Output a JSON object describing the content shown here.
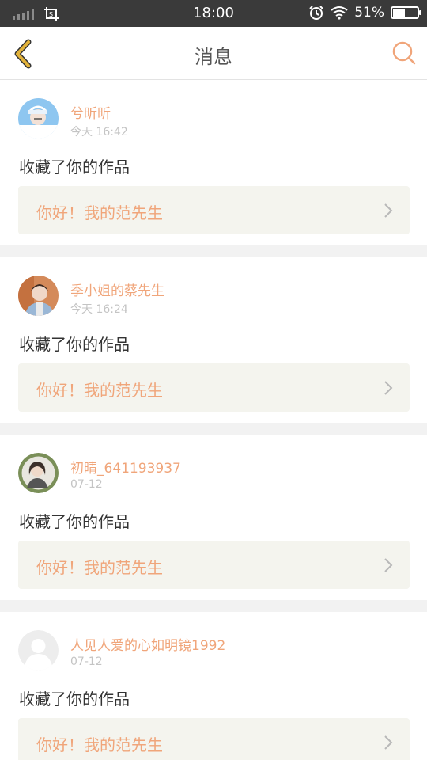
{
  "status_bar": {
    "time": "18:00",
    "battery_text": "51%",
    "battery_level": 0.51,
    "icons": [
      "signal-icon",
      "screenshot-crop-icon",
      "alarm-icon",
      "wifi-icon",
      "battery-icon"
    ]
  },
  "header": {
    "title": "消息",
    "back_icon": "chevron-left-icon",
    "search_icon": "search-icon"
  },
  "colors": {
    "accent": "#f0a57a",
    "back_icon": "#e2b23a",
    "status_bar": "#3a3a3a"
  },
  "messages": [
    {
      "username": "兮昕昕",
      "time": "今天 16:42",
      "action": "收藏了你的作品",
      "work_title": "你好！我的范先生"
    },
    {
      "username": "季小姐的蔡先生",
      "time": "今天 16:24",
      "action": "收藏了你的作品",
      "work_title": "你好！我的范先生"
    },
    {
      "username": "初晴_641193937",
      "time": "07-12",
      "action": "收藏了你的作品",
      "work_title": "你好！我的范先生"
    },
    {
      "username": "人见人爱的心如明镜1992",
      "time": "07-12",
      "action": "收藏了你的作品",
      "work_title": "你好！我的范先生"
    }
  ]
}
